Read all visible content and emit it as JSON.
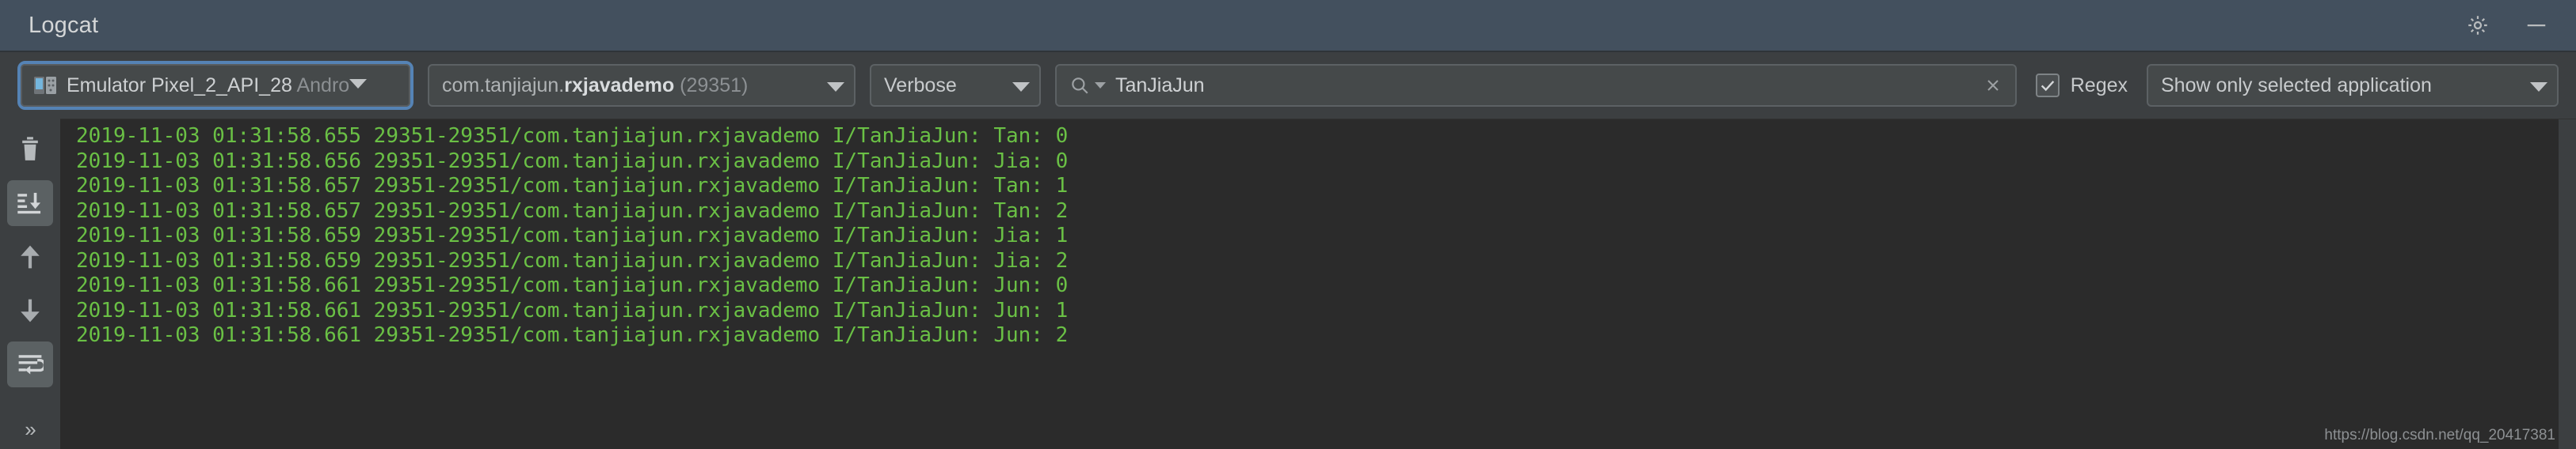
{
  "window": {
    "title": "Logcat",
    "settings_icon": "gear-icon",
    "minimize_icon": "minimize-icon"
  },
  "toolbar": {
    "device": {
      "name": "Emulator Pixel_2_API_28",
      "suffix": " Andro",
      "icon": "device-emulator-icon"
    },
    "process": {
      "package_prefix": "com.tanjiajun.",
      "package_name": "rxjavademo",
      "pid": "(29351)"
    },
    "log_level": "Verbose",
    "search": {
      "value": "TanJiaJun",
      "placeholder": "",
      "icon": "search-icon",
      "clear_icon": "clear-icon"
    },
    "regex": {
      "label": "Regex",
      "checked": true
    },
    "scope": "Show only selected application"
  },
  "sidebar": {
    "items": [
      {
        "name": "clear-logcat-button",
        "icon": "trash-icon",
        "active": false
      },
      {
        "name": "scroll-to-end-button",
        "icon": "scroll-to-end-icon",
        "active": true
      },
      {
        "name": "up-the-stack-trace-button",
        "icon": "arrow-up-icon",
        "active": false
      },
      {
        "name": "down-the-stack-trace-button",
        "icon": "arrow-down-icon",
        "active": false
      },
      {
        "name": "soft-wrap-button",
        "icon": "soft-wrap-icon",
        "active": true
      }
    ],
    "more_label": "»"
  },
  "console": {
    "text_color": "#6ac045",
    "background": "#2b2b2b",
    "lines": [
      "2019-11-03 01:31:58.655 29351-29351/com.tanjiajun.rxjavademo I/TanJiaJun: Tan: 0",
      "2019-11-03 01:31:58.656 29351-29351/com.tanjiajun.rxjavademo I/TanJiaJun: Jia: 0",
      "2019-11-03 01:31:58.657 29351-29351/com.tanjiajun.rxjavademo I/TanJiaJun: Tan: 1",
      "2019-11-03 01:31:58.657 29351-29351/com.tanjiajun.rxjavademo I/TanJiaJun: Tan: 2",
      "2019-11-03 01:31:58.659 29351-29351/com.tanjiajun.rxjavademo I/TanJiaJun: Jia: 1",
      "2019-11-03 01:31:58.659 29351-29351/com.tanjiajun.rxjavademo I/TanJiaJun: Jia: 2",
      "2019-11-03 01:31:58.661 29351-29351/com.tanjiajun.rxjavademo I/TanJiaJun: Jun: 0",
      "2019-11-03 01:31:58.661 29351-29351/com.tanjiajun.rxjavademo I/TanJiaJun: Jun: 1",
      "2019-11-03 01:31:58.661 29351-29351/com.tanjiajun.rxjavademo I/TanJiaJun: Jun: 2"
    ]
  },
  "watermark": "https://blog.csdn.net/qq_20417381"
}
